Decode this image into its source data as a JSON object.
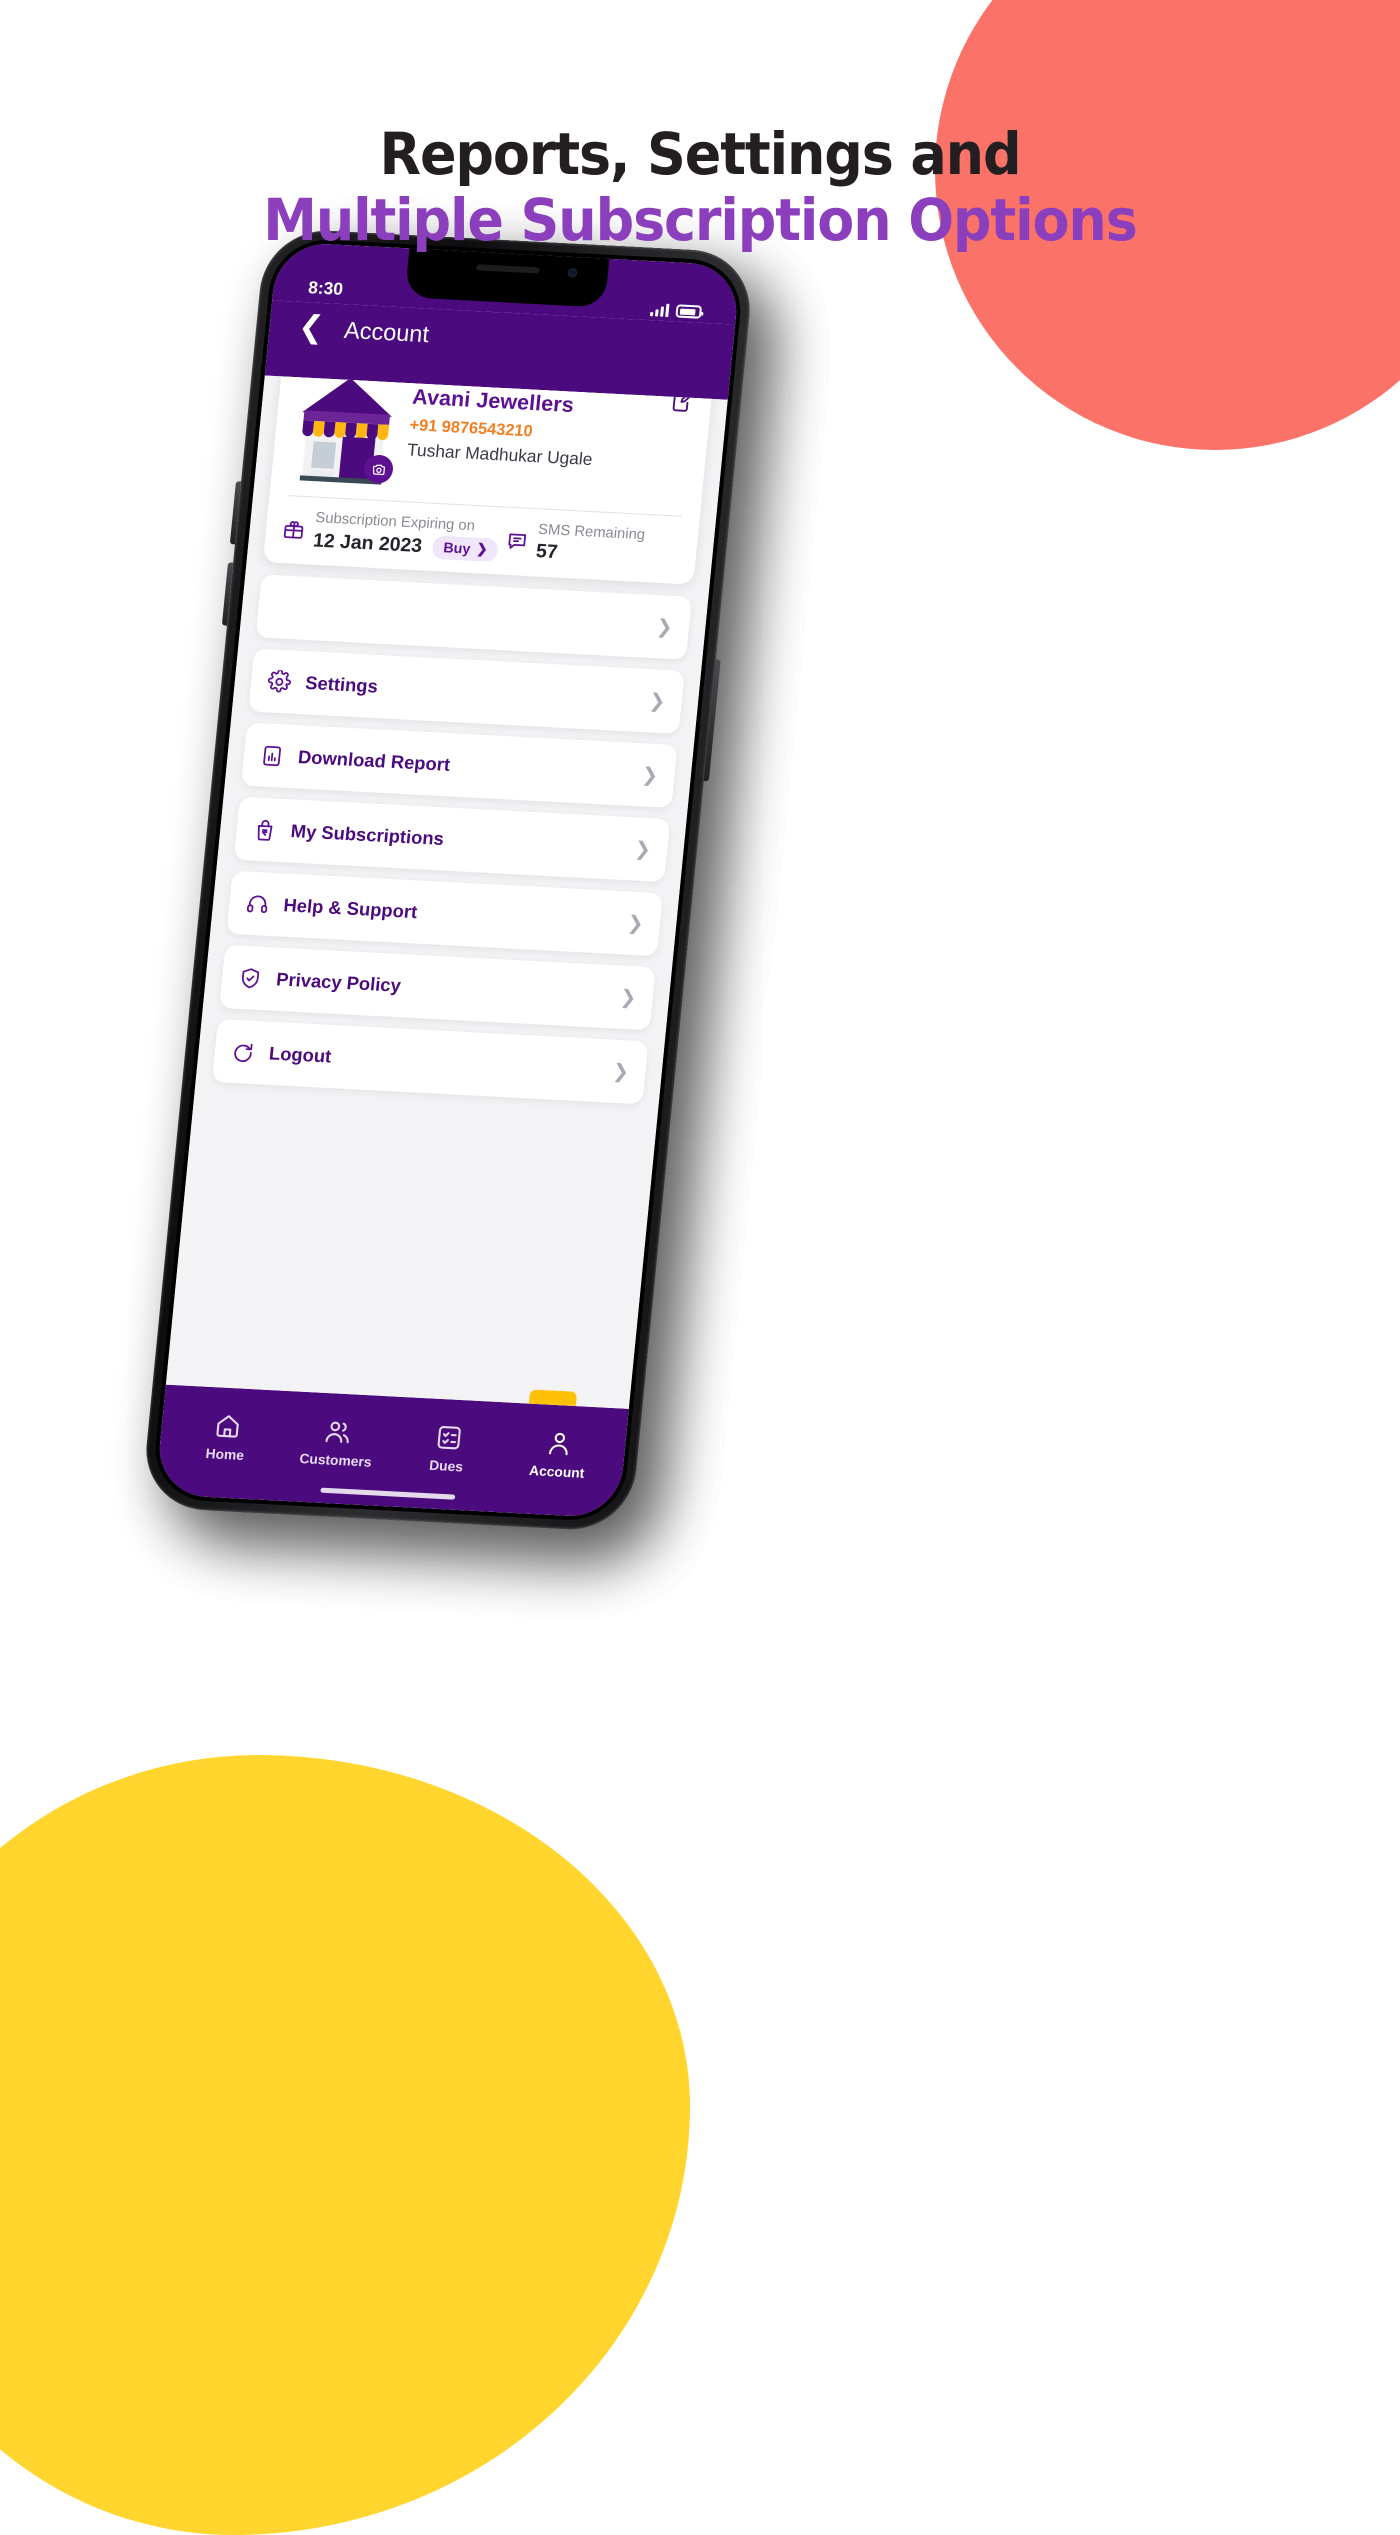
{
  "headline": {
    "line1": "Reports, Settings and",
    "line2": "Multiple Subscription Options"
  },
  "colors": {
    "brand_purple": "#4b0a7d",
    "accent_purple": "#8b3fbd",
    "coral": "#fa7268",
    "yellow": "#ffd52e",
    "orange": "#f08022",
    "heading_dark": "#231f20"
  },
  "phone": {
    "status_bar": {
      "time": "8:30",
      "signal_icon": "signal-bars-icon",
      "battery_icon": "battery-icon"
    },
    "app_bar": {
      "back_icon": "chevron-left-icon",
      "title": "Account"
    },
    "profile": {
      "edit_icon": "edit-note-icon",
      "shop_icon": "shop-storefront-icon",
      "camera_badge_icon": "camera-icon",
      "business_name": "Avani Jewellers",
      "phone": "+91 9876543210",
      "owner_name": "Tushar Madhukar Ugale",
      "subscription": {
        "icon": "gift-icon",
        "label": "Subscription Expiring on",
        "value": "12 Jan 2023",
        "buy_label": "Buy",
        "buy_chevron": "chevron-right-icon"
      },
      "sms": {
        "icon": "chat-message-icon",
        "label": "SMS Remaining",
        "value": "57"
      }
    },
    "menu": [
      {
        "label": "",
        "icon": "blank-icon",
        "chevron": "chevron-right-icon"
      },
      {
        "label": "Settings",
        "icon": "gear-icon",
        "chevron": "chevron-right-icon"
      },
      {
        "label": "Download Report",
        "icon": "bar-chart-document-icon",
        "chevron": "chevron-right-icon"
      },
      {
        "label": "My Subscriptions",
        "icon": "rupee-bag-icon",
        "chevron": "chevron-right-icon"
      },
      {
        "label": "Help & Support",
        "icon": "headset-icon",
        "chevron": "chevron-right-icon"
      },
      {
        "label": "Privacy Policy",
        "icon": "shield-check-icon",
        "chevron": "chevron-right-icon"
      },
      {
        "label": "Logout",
        "icon": "logout-icon",
        "chevron": "chevron-right-icon"
      }
    ],
    "bottom_nav": [
      {
        "label": "Home",
        "icon": "home-icon",
        "active": false
      },
      {
        "label": "Customers",
        "icon": "customers-icon",
        "active": false
      },
      {
        "label": "Dues",
        "icon": "dues-checklist-icon",
        "active": false
      },
      {
        "label": "Account",
        "icon": "account-person-icon",
        "active": true
      }
    ]
  }
}
